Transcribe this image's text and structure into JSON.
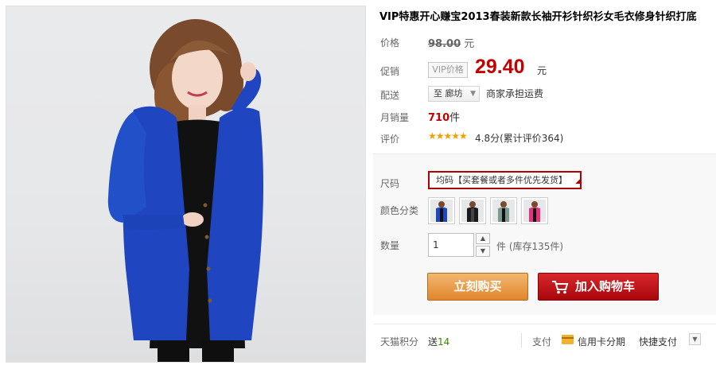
{
  "product": {
    "title": "VIP特惠开心赚宝2013春装新款长袖开衫针织衫女毛衣修身针织打底"
  },
  "price": {
    "label": "价格",
    "original": "98.00",
    "unit": "元"
  },
  "promo": {
    "label": "促销",
    "tag": "VIP价格",
    "price": "29.40",
    "unit": "元"
  },
  "shipping": {
    "label": "配送",
    "location": "至 廊坊",
    "note": "商家承担运费"
  },
  "sales": {
    "label": "月销量",
    "count": "710",
    "unit": "件"
  },
  "review": {
    "label": "评价",
    "stars": "★★★★★",
    "score_text": "4.8分(累计评价364)"
  },
  "options": {
    "size_label": "尺码",
    "size_value": "均码【买套餐或者多件优先发货】",
    "color_label": "颜色分类",
    "colors": [
      {
        "name": "blue",
        "hex": "#1f47c0"
      },
      {
        "name": "black",
        "hex": "#1a1a1a"
      },
      {
        "name": "gray-green",
        "hex": "#7c9a92"
      },
      {
        "name": "rose",
        "hex": "#e8317a"
      }
    ]
  },
  "quantity": {
    "label": "数量",
    "value": "1",
    "stock_text": "件 (库存135件)"
  },
  "actions": {
    "buy_now": "立刻购买",
    "add_to_cart": "加入购物车"
  },
  "footer": {
    "points_label": "天猫积分",
    "points_prefix": "送",
    "points_value": "14",
    "pay_label": "支付",
    "credit_label": "信用卡分期",
    "quick_pay": "快捷支付"
  },
  "colors": {
    "price_red": "#c40000",
    "buy_orange": "#e0862c",
    "cart_red": "#a8070c"
  }
}
